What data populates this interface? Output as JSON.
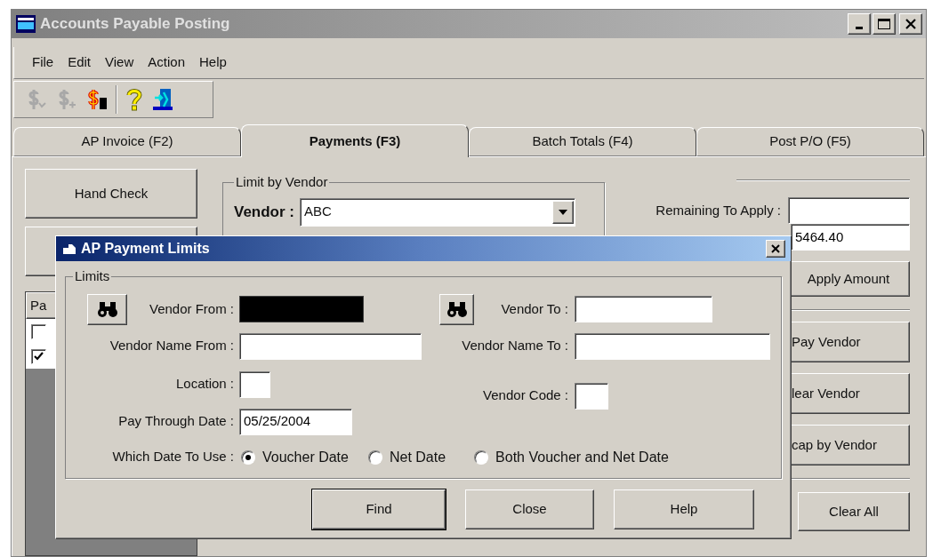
{
  "window": {
    "title": "Accounts Payable Posting",
    "active": false
  },
  "menu": [
    "File",
    "Edit",
    "View",
    "Action",
    "Help"
  ],
  "toolbar": [
    {
      "kind": "post",
      "disabled": true
    },
    {
      "kind": "add",
      "disabled": true
    },
    {
      "kind": "pay",
      "disabled": false
    },
    {
      "kind": "help",
      "disabled": false
    },
    {
      "kind": "exit",
      "disabled": false
    }
  ],
  "tabs": [
    {
      "label": "AP Invoice (F2)",
      "selected": false
    },
    {
      "label": "Payments (F3)",
      "selected": true
    },
    {
      "label": "Batch Totals (F4)",
      "selected": false
    },
    {
      "label": "Post P/O (F5)",
      "selected": false
    }
  ],
  "hand_check_button": "Hand Check",
  "list": {
    "column_1": "Pa",
    "rows": [
      {
        "checked": false
      },
      {
        "checked": true
      }
    ]
  },
  "limit_by_vendor": {
    "legend": "Limit by Vendor",
    "vendor_label": "Vendor :",
    "vendor_value": "ABC"
  },
  "right_panel": {
    "remaining_label": "Remaining To Apply :",
    "amount_value": "5464.40",
    "apply_button": "Apply Amount",
    "vendor_buttons": [
      "Pay Vendor",
      "lear Vendor",
      "cap by Vendor"
    ],
    "clear_all_button": "Clear All"
  },
  "dialog": {
    "title": "AP Payment Limits",
    "active": true,
    "legend": "Limits",
    "vendor_from": {
      "label": "Vendor From :",
      "focused": true
    },
    "vendor_to": {
      "label": "Vendor To :",
      "focused": false
    },
    "vendor_name_from": {
      "label": "Vendor Name From :"
    },
    "vendor_name_to": {
      "label": "Vendor Name To :"
    },
    "location": {
      "label": "Location :"
    },
    "vendor_code": {
      "label": "Vendor Code :"
    },
    "pay_through_date": {
      "label": "Pay Through Date  :",
      "value": "05/25/2004"
    },
    "which_date": {
      "label": "Which Date To Use :",
      "options": [
        {
          "label": "Voucher Date",
          "selected": true
        },
        {
          "label": "Net Date",
          "selected": false
        },
        {
          "label": "Both Voucher and Net Date",
          "selected": false
        }
      ]
    },
    "buttons": [
      "Find",
      "Close",
      "Help"
    ]
  }
}
